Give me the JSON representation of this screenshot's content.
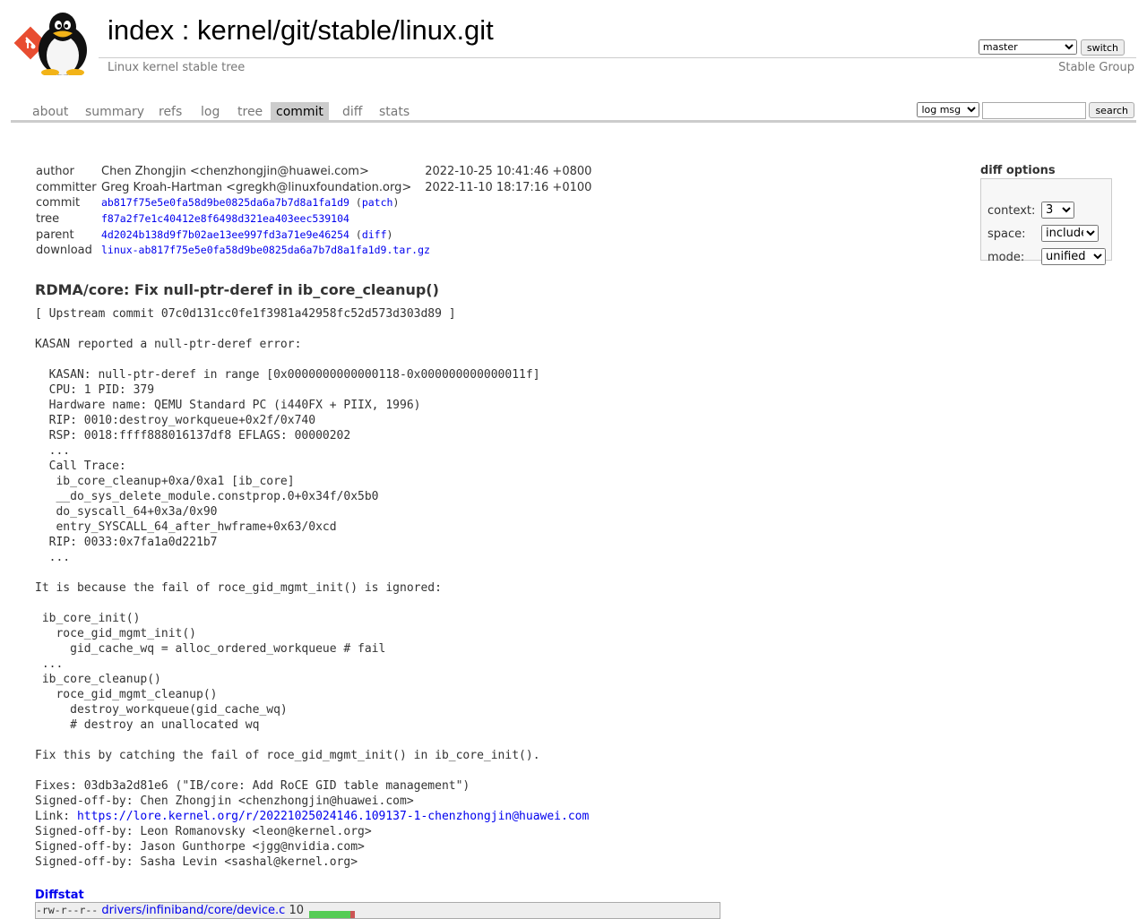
{
  "header": {
    "title_prefix": "index",
    "title_sep": " : ",
    "repo_path": "kernel/git/stable/linux.git",
    "description": "Linux kernel stable tree",
    "owner": "Stable Group",
    "branch_selected": "master",
    "switch_label": "switch"
  },
  "tabs": [
    "about",
    "summary",
    "refs",
    "log",
    "tree",
    "commit",
    "diff",
    "stats"
  ],
  "active_tab": "commit",
  "search": {
    "mode_selected": "log msg",
    "button_label": "search",
    "placeholder": ""
  },
  "meta": {
    "author": {
      "label": "author",
      "value": "Chen Zhongjin <chenzhongjin@huawei.com>",
      "date": "2022-10-25 10:41:46 +0800"
    },
    "committer": {
      "label": "committer",
      "value": "Greg Kroah-Hartman <gregkh@linuxfoundation.org>",
      "date": "2022-11-10 18:17:16 +0100"
    },
    "commit": {
      "label": "commit",
      "hash": "ab817f75e5e0fa58d9be0825da6a7b7d8a1fa1d9",
      "suffix_open": " (",
      "link": "patch",
      "suffix_close": ")"
    },
    "tree": {
      "label": "tree",
      "hash": "f87a2f7e1c40412e8f6498d321ea403eec539104"
    },
    "parent": {
      "label": "parent",
      "hash": "4d2024b138d9f7b02ae13ee997fd3a71e9e46254",
      "suffix_open": " (",
      "link": "diff",
      "suffix_close": ")"
    },
    "download": {
      "label": "download",
      "file": "linux-ab817f75e5e0fa58d9be0825da6a7b7d8a1fa1d9.tar.gz"
    }
  },
  "commit_subject": "RDMA/core: Fix null-ptr-deref in ib_core_cleanup()",
  "commit_body_pre": "[ Upstream commit 07c0d131cc0fe1f3981a42958fc52d573d303d89 ]\n\nKASAN reported a null-ptr-deref error:\n\n  KASAN: null-ptr-deref in range [0x0000000000000118-0x000000000000011f]\n  CPU: 1 PID: 379\n  Hardware name: QEMU Standard PC (i440FX + PIIX, 1996)\n  RIP: 0010:destroy_workqueue+0x2f/0x740\n  RSP: 0018:ffff888016137df8 EFLAGS: 00000202\n  ...\n  Call Trace:\n   ib_core_cleanup+0xa/0xa1 [ib_core]\n   __do_sys_delete_module.constprop.0+0x34f/0x5b0\n   do_syscall_64+0x3a/0x90\n   entry_SYSCALL_64_after_hwframe+0x63/0xcd\n  RIP: 0033:0x7fa1a0d221b7\n  ...\n\nIt is because the fail of roce_gid_mgmt_init() is ignored:\n\n ib_core_init()\n   roce_gid_mgmt_init()\n     gid_cache_wq = alloc_ordered_workqueue # fail\n ...\n ib_core_cleanup()\n   roce_gid_mgmt_cleanup()\n     destroy_workqueue(gid_cache_wq)\n     # destroy an unallocated wq\n\nFix this by catching the fail of roce_gid_mgmt_init() in ib_core_init().\n\nFixes: 03db3a2d81e6 (\"IB/core: Add RoCE GID table management\")\nSigned-off-by: Chen Zhongjin <chenzhongjin@huawei.com>\nLink: ",
  "commit_link": "https://lore.kernel.org/r/20221025024146.109137-1-chenzhongjin@huawei.com",
  "commit_body_post": "\nSigned-off-by: Leon Romanovsky <leon@kernel.org>\nSigned-off-by: Jason Gunthorpe <jgg@nvidia.com>\nSigned-off-by: Sasha Levin <sashal@kernel.org>",
  "diff_options": {
    "title": "diff options",
    "context_label": "context:",
    "context_value": "3",
    "space_label": "space:",
    "space_value": "include",
    "mode_label": "mode:",
    "mode_value": "unified"
  },
  "diffstat": {
    "title": "Diffstat",
    "files": [
      {
        "perm": "-rw-r--r--",
        "path": "drivers/infiniband/core/device.c",
        "changes": "10",
        "added_fraction": 0.9,
        "removed_fraction": 0.1
      }
    ]
  },
  "colors": {
    "added": "#55cc55",
    "removed": "#cc5555",
    "tab_active_bg": "#cccccc",
    "link": "#0000ee"
  }
}
